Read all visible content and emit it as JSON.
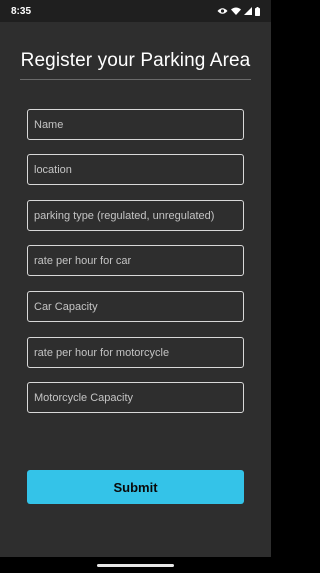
{
  "status_bar": {
    "time": "8:35",
    "icons": [
      "eye-icon",
      "wifi-icon",
      "signal-icon",
      "battery-icon"
    ]
  },
  "page": {
    "title": "Register your Parking Area"
  },
  "form": {
    "fields": [
      {
        "placeholder": "Name",
        "value": ""
      },
      {
        "placeholder": "location",
        "value": ""
      },
      {
        "placeholder": "parking type (regulated, unregulated)",
        "value": ""
      },
      {
        "placeholder": "rate per hour for car",
        "value": ""
      },
      {
        "placeholder": "Car Capacity",
        "value": ""
      },
      {
        "placeholder": "rate per hour for motorcycle",
        "value": ""
      },
      {
        "placeholder": "Motorcycle Capacity",
        "value": ""
      }
    ],
    "submit_label": "Submit"
  },
  "colors": {
    "background": "#2e2e2e",
    "status_bar": "#1f1f1f",
    "accent": "#34c3e8",
    "field_border": "#d8d8d8"
  }
}
